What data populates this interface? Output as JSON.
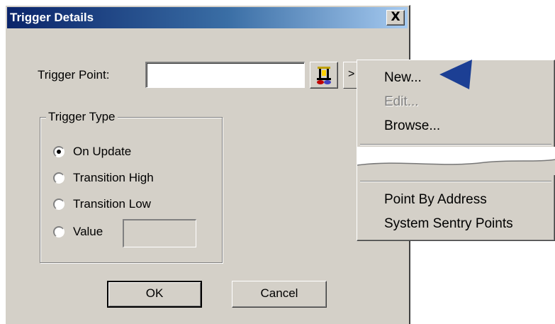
{
  "dialog": {
    "title": "Trigger Details",
    "close_label": "X",
    "trigger_point_label": "Trigger Point:",
    "trigger_point_value": "",
    "point_picker_icon": "point-browser-icon",
    "menu_button_label": ">",
    "trigger_type": {
      "legend": "Trigger Type",
      "options": [
        {
          "label": "On Update",
          "selected": true
        },
        {
          "label": "Transition High",
          "selected": false
        },
        {
          "label": "Transition Low",
          "selected": false
        },
        {
          "label": "Value",
          "selected": false
        }
      ],
      "value_field": ""
    },
    "ok_label": "OK",
    "cancel_label": "Cancel"
  },
  "context_menu": {
    "items": [
      {
        "label": "New...",
        "enabled": true
      },
      {
        "label": "Edit...",
        "enabled": false
      },
      {
        "label": "Browse...",
        "enabled": true
      },
      {
        "label": "Point By Address",
        "enabled": true
      },
      {
        "label": "System Sentry Points",
        "enabled": true
      }
    ]
  },
  "colors": {
    "face": "#d4d0c8",
    "title_gradient_start": "#0a246a",
    "title_gradient_end": "#a6caf0",
    "arrow": "#1c3f94"
  }
}
